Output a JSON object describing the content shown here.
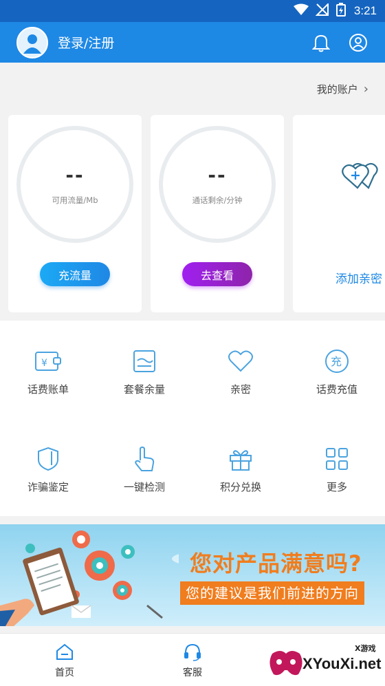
{
  "status_bar": {
    "time": "3:21"
  },
  "header": {
    "login_label": "登录/注册",
    "accent": "#1e88e5"
  },
  "account": {
    "label": "我的账户"
  },
  "cards": [
    {
      "value": "--",
      "label": "可用流量/Mb",
      "button": "充流量"
    },
    {
      "value": "--",
      "label": "通话剩余/分钟",
      "button": "去查看"
    },
    {
      "link": "添加亲密"
    }
  ],
  "grid": [
    {
      "label": "话费账单",
      "icon": "wallet-icon"
    },
    {
      "label": "套餐余量",
      "icon": "package-icon"
    },
    {
      "label": "亲密",
      "icon": "heart-icon"
    },
    {
      "label": "话费充值",
      "icon": "recharge-icon"
    },
    {
      "label": "诈骗鉴定",
      "icon": "shield-icon"
    },
    {
      "label": "一键检测",
      "icon": "tap-icon"
    },
    {
      "label": "积分兑换",
      "icon": "gift-icon"
    },
    {
      "label": "更多",
      "icon": "more-icon"
    }
  ],
  "banner": {
    "title": "您对产品满意吗?",
    "subtitle": "您的建议是我们前进的方向"
  },
  "tabs": [
    {
      "label": "首页",
      "icon": "home-icon"
    },
    {
      "label": "客服",
      "icon": "headset-icon"
    }
  ],
  "watermark": {
    "text": "XYouXi.net",
    "small": "X游戏"
  }
}
